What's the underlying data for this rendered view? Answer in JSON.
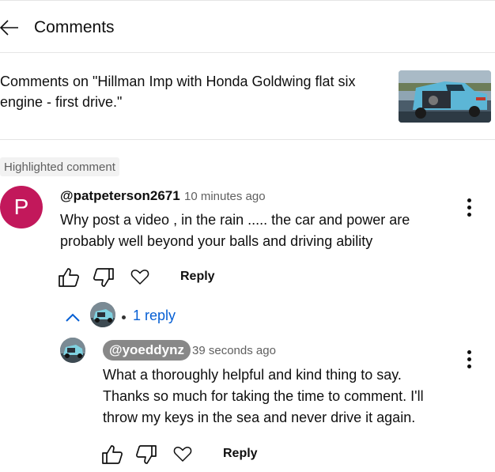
{
  "header": {
    "title": "Comments"
  },
  "video": {
    "title_line1": "Comments on \"Hillman Imp with Honda Goldwing flat six",
    "title_line2": "engine - first drive.\""
  },
  "highlight_label": "Highlighted comment",
  "comment": {
    "avatar_letter": "P",
    "avatar_color": "#c2185b",
    "author": "@patpeterson2671",
    "time": "10 minutes ago",
    "text_line1": "Why post a video , in the rain ..... the car and power are",
    "text_line2": "probably well beyond your balls and driving ability",
    "reply_label": "Reply"
  },
  "replies_toggle": {
    "count_label": "1 reply"
  },
  "reply": {
    "author": "@yoeddynz",
    "time": "39 seconds ago",
    "text_line1": "What a thoroughly helpful and kind thing to say.",
    "text_line2": "Thanks so much for taking the time to comment. I'll",
    "text_line3": "throw my keys in the sea and never drive it again.",
    "reply_label": "Reply"
  },
  "colors": {
    "link_blue": "#065fd4",
    "divider": "#e5e5e5",
    "secondary_text": "#606060"
  },
  "icons": [
    "back-arrow-icon",
    "thumbs-up-icon",
    "thumbs-down-icon",
    "heart-icon",
    "more-vert-icon",
    "chevron-up-icon"
  ]
}
